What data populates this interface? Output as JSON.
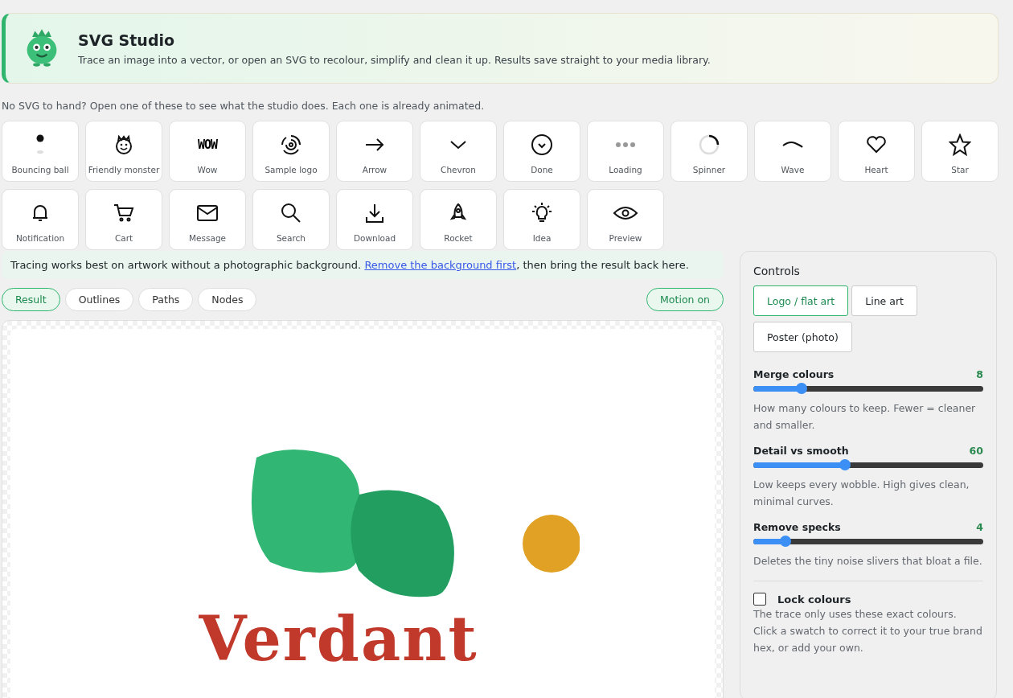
{
  "header": {
    "title": "SVG Studio",
    "subtitle": "Trace an image into a vector, or open an SVG to recolour, simplify and clean it up. Results save straight to your media library."
  },
  "samples_caption": "No SVG to hand? Open one of these to see what the studio does. Each one is already animated.",
  "samples": [
    {
      "kind": "ball",
      "label": "Bouncing ball"
    },
    {
      "kind": "monster",
      "label": "Friendly monster"
    },
    {
      "kind": "wow",
      "label": "Wow",
      "glyph": "WOW"
    },
    {
      "kind": "logo",
      "label": "Sample logo"
    },
    {
      "kind": "arrow",
      "label": "Arrow"
    },
    {
      "kind": "chevron",
      "label": "Chevron"
    },
    {
      "kind": "done",
      "label": "Done"
    },
    {
      "kind": "loading",
      "label": "Loading"
    },
    {
      "kind": "spinner",
      "label": "Spinner"
    },
    {
      "kind": "wave",
      "label": "Wave"
    },
    {
      "kind": "heart",
      "label": "Heart"
    },
    {
      "kind": "star",
      "label": "Star"
    },
    {
      "kind": "bell",
      "label": "Notification"
    },
    {
      "kind": "cart",
      "label": "Cart"
    },
    {
      "kind": "mail",
      "label": "Message"
    },
    {
      "kind": "search",
      "label": "Search"
    },
    {
      "kind": "download",
      "label": "Download"
    },
    {
      "kind": "rocket",
      "label": "Rocket"
    },
    {
      "kind": "idea",
      "label": "Idea"
    },
    {
      "kind": "eye",
      "label": "Preview"
    }
  ],
  "notice": {
    "before": "Tracing works best on artwork without a photographic background. ",
    "link": "Remove the background first",
    "after": ", then bring the result back here."
  },
  "view_tabs": [
    {
      "label": "Result",
      "selected": true
    },
    {
      "label": "Outlines",
      "selected": false
    },
    {
      "label": "Paths",
      "selected": false
    },
    {
      "label": "Nodes",
      "selected": false
    }
  ],
  "motion_toggle": {
    "label": "Motion on",
    "on": true
  },
  "preview": {
    "logo_text": "Verdant"
  },
  "controls": {
    "title": "Controls",
    "presets": [
      {
        "label": "Logo / flat art",
        "selected": true
      },
      {
        "label": "Line art",
        "selected": false
      },
      {
        "label": "Poster (photo)",
        "selected": false
      }
    ],
    "sliders": [
      {
        "label": "Merge colours",
        "value": "8",
        "level": 0.21,
        "hint": "How many colours to keep. Fewer = cleaner and smaller."
      },
      {
        "label": "Detail vs smooth",
        "value": "60",
        "level": 0.4,
        "hint": "Low keeps every wobble. High gives clean, minimal curves."
      },
      {
        "label": "Remove specks",
        "value": "4",
        "level": 0.14,
        "hint": "Deletes the tiny noise slivers that bloat a file."
      }
    ],
    "lock": {
      "label": "Lock colours",
      "checked": false,
      "hint": "The trace only uses these exact colours. Click a swatch to correct it to your true brand hex, or add your own."
    }
  }
}
